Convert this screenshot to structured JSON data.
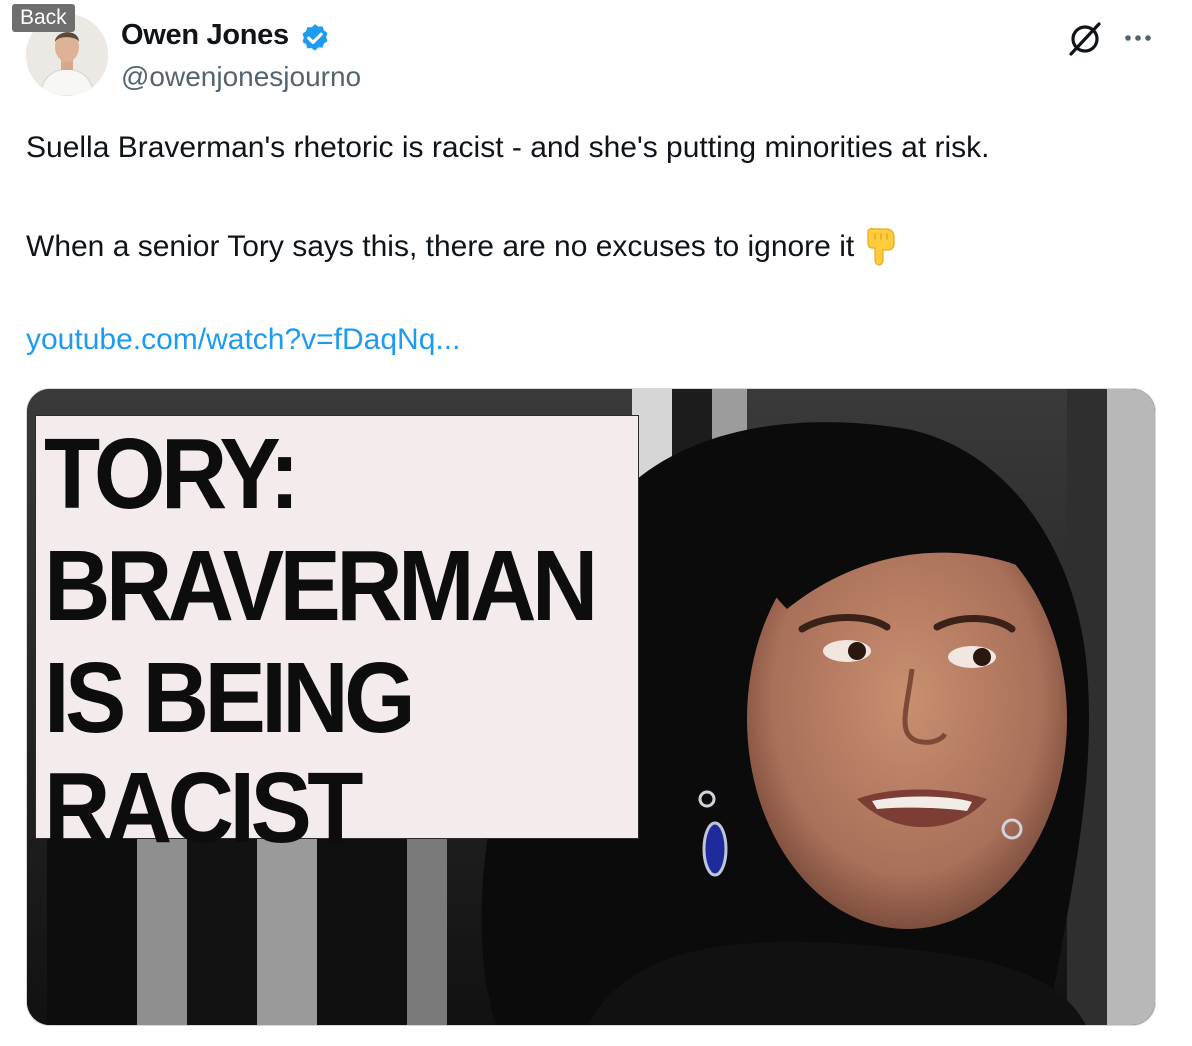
{
  "back_label": "Back",
  "author": {
    "name": "Owen Jones",
    "handle": "@owenjonesjourno"
  },
  "tweet": {
    "line1": "Suella Braverman's rhetoric is racist - and she's putting minorities at risk.",
    "line2": "When a senior Tory says this, there are no excuses to ignore it",
    "emoji": "pointing-down-hand-icon",
    "link": "youtube.com/watch?v=fDaqNq..."
  },
  "media": {
    "headline_lines": [
      "TORY:",
      "BRAVERMAN",
      "IS BEING",
      "RACIST"
    ]
  },
  "colors": {
    "link": "#1d9bf0",
    "verified": "#1d9bf0",
    "handle": "#536471"
  }
}
